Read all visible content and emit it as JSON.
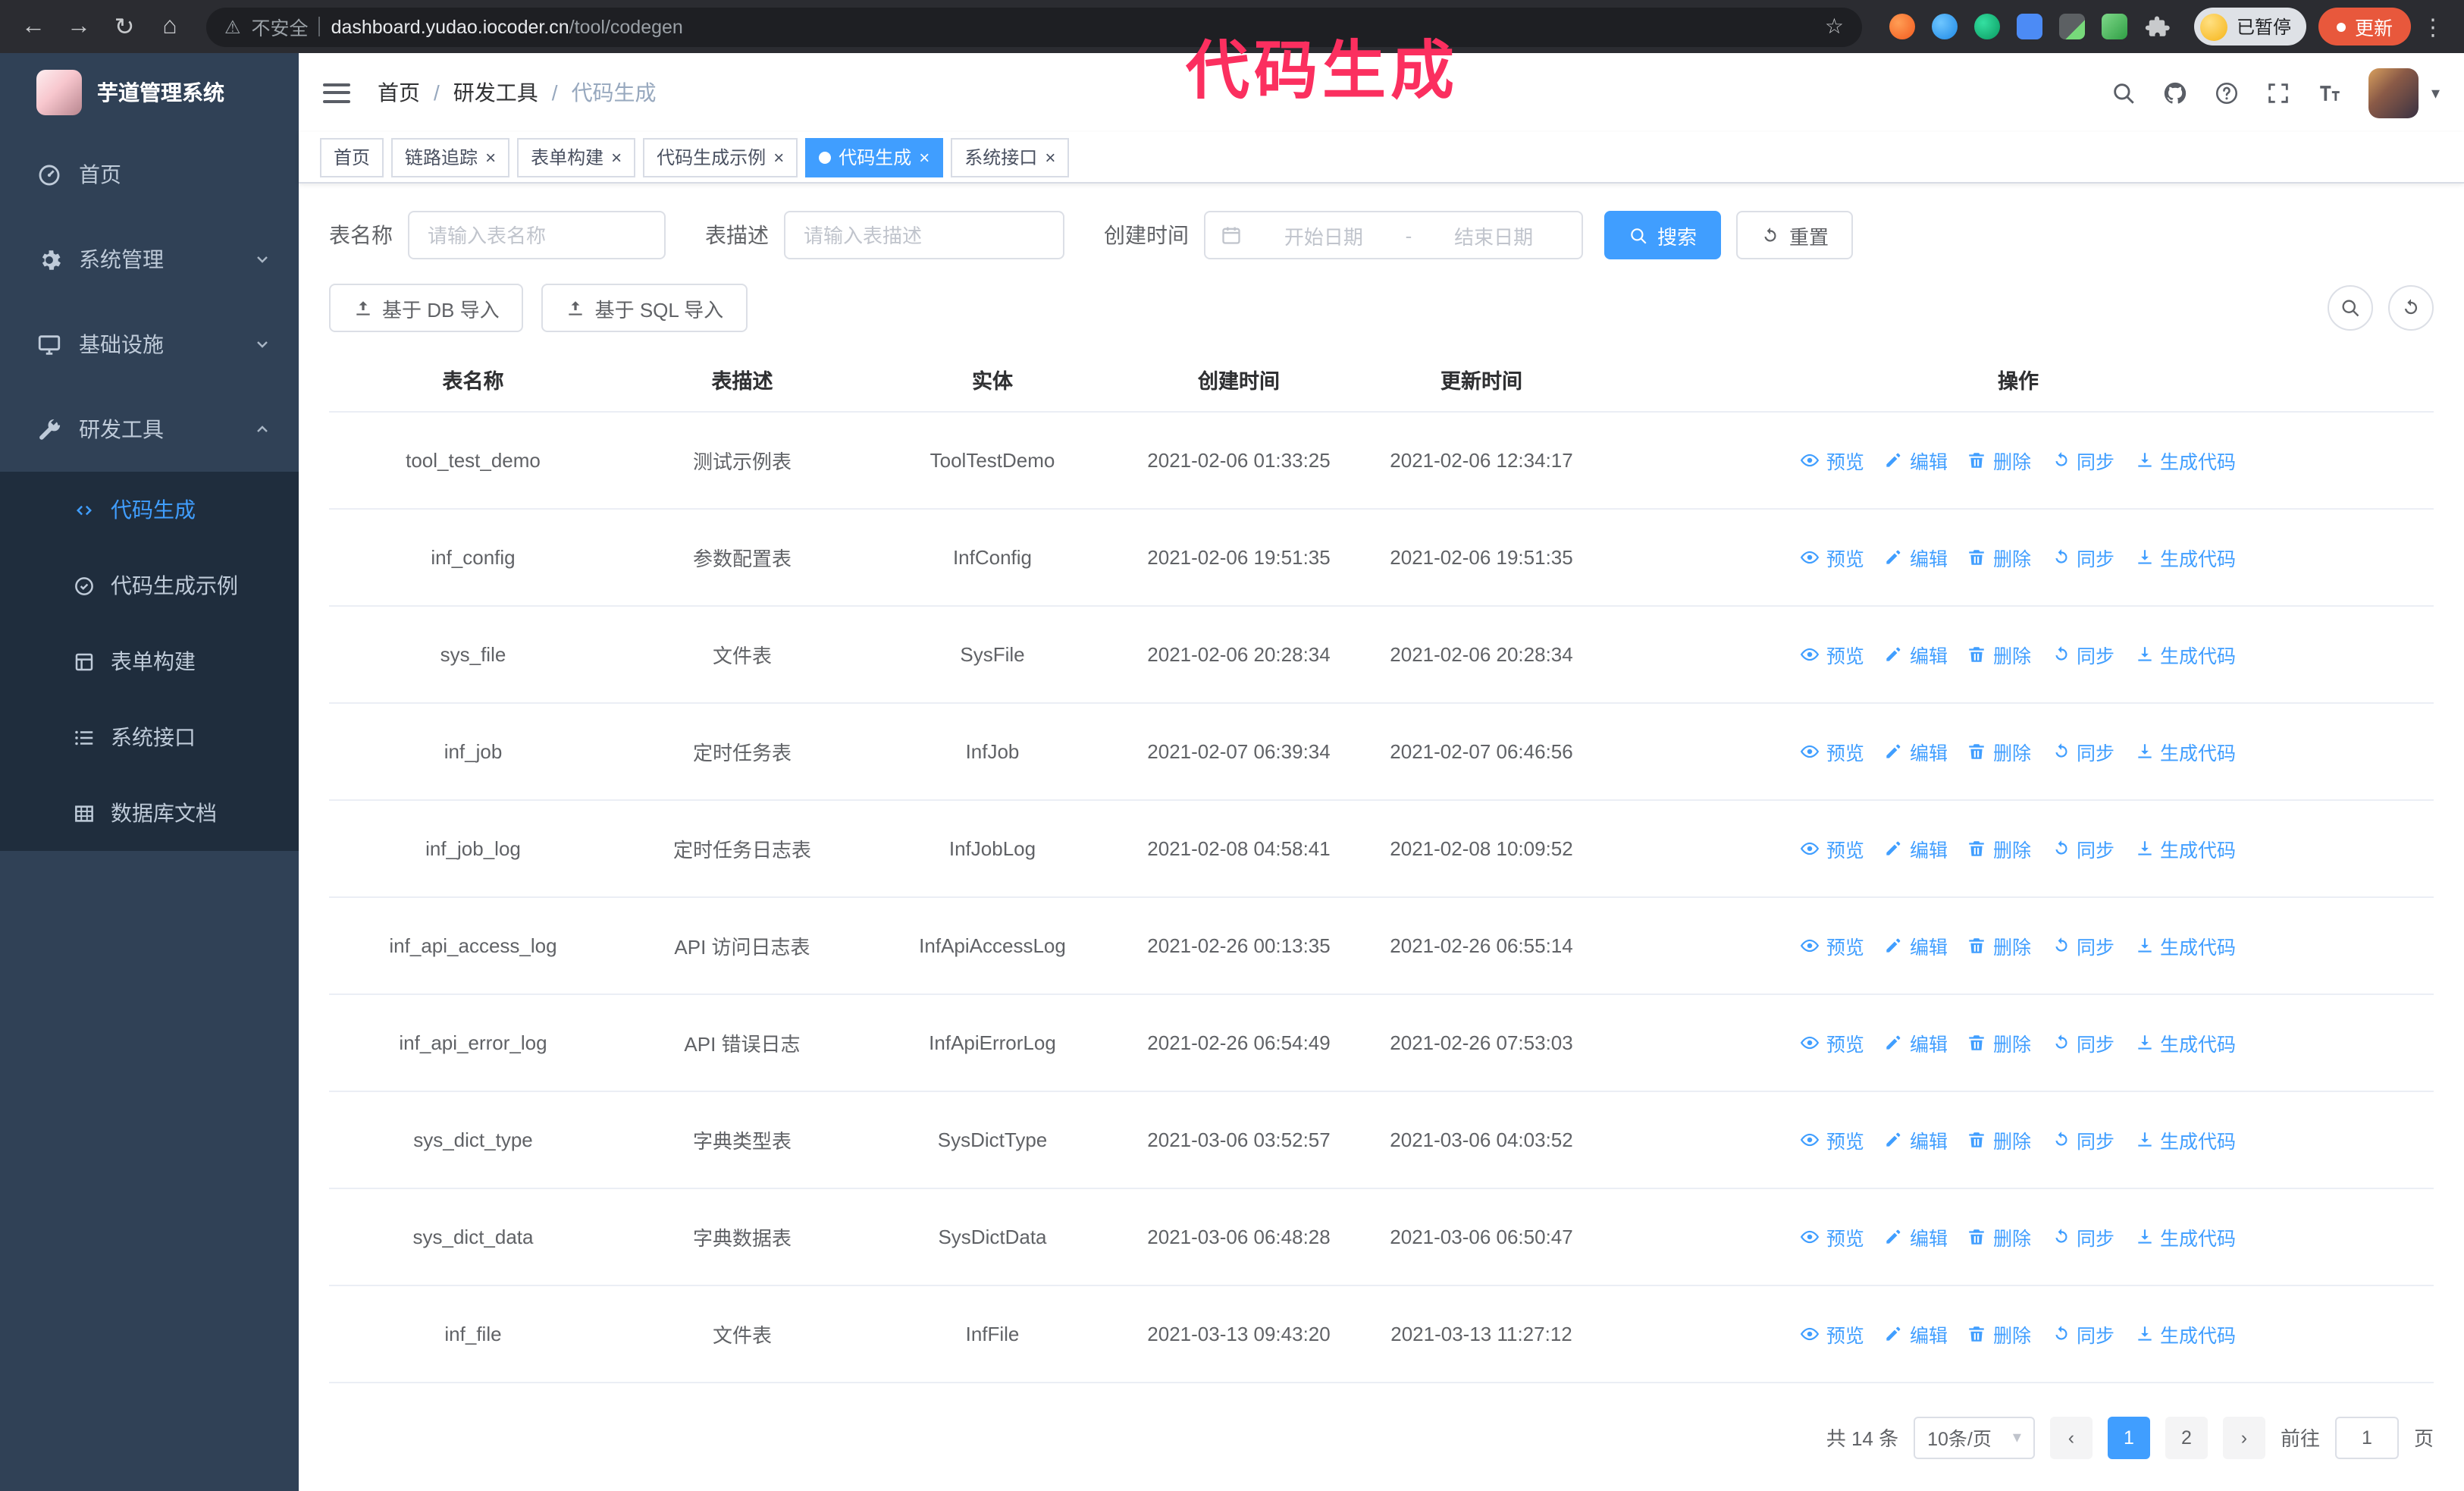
{
  "colors": {
    "accent": "#409eff",
    "sidebar_bg": "#304156",
    "submenu_bg": "#1f2d3d",
    "overlay_pink": "#fb2f5f",
    "update_button_bg": "#e8583c",
    "chrome_bg": "#2b2c31"
  },
  "icons": {
    "back": "←",
    "forward": "→",
    "reload": "↻",
    "home": "⌂",
    "warning": "⚠",
    "star": "☆",
    "kebab": "⋮",
    "close": "×",
    "caret": "▾",
    "prev": "‹",
    "next": "›"
  },
  "overlay_title": "代码生成",
  "browser": {
    "security_label": "不安全",
    "url_host": "dashboard.yudao.iocoder.cn",
    "url_path": "/tool/codegen",
    "paused_badge": "已暂停",
    "update_button": "更新"
  },
  "sidebar": {
    "logo_title": "芋道管理系统",
    "items": [
      {
        "label": "首页"
      },
      {
        "label": "系统管理"
      },
      {
        "label": "基础设施"
      },
      {
        "label": "研发工具"
      }
    ],
    "sub_items": [
      {
        "label": "代码生成"
      },
      {
        "label": "代码生成示例"
      },
      {
        "label": "表单构建"
      },
      {
        "label": "系统接口"
      },
      {
        "label": "数据库文档"
      }
    ]
  },
  "header": {
    "breadcrumb": [
      "首页",
      "研发工具",
      "代码生成"
    ],
    "separator": "/"
  },
  "tabs": [
    {
      "label": "首页"
    },
    {
      "label": "链路追踪"
    },
    {
      "label": "表单构建"
    },
    {
      "label": "代码生成示例"
    },
    {
      "label": "代码生成"
    },
    {
      "label": "系统接口"
    }
  ],
  "filters": {
    "name_label": "表名称",
    "name_placeholder": "请输入表名称",
    "desc_label": "表描述",
    "desc_placeholder": "请输入表描述",
    "time_label": "创建时间",
    "start_placeholder": "开始日期",
    "range_separator": "-",
    "end_placeholder": "结束日期",
    "search_label": "搜索",
    "reset_label": "重置"
  },
  "toolbar": {
    "import_db": "基于 DB 导入",
    "import_sql": "基于 SQL 导入"
  },
  "table": {
    "columns": [
      "表名称",
      "表描述",
      "实体",
      "创建时间",
      "更新时间",
      "操作"
    ],
    "ops": {
      "preview": "预览",
      "edit": "编辑",
      "delete": "删除",
      "sync": "同步",
      "generate": "生成代码"
    },
    "rows": [
      {
        "name": "tool_test_demo",
        "desc": "测试示例表",
        "entity": "ToolTestDemo",
        "created": "2021-02-06 01:33:25",
        "updated": "2021-02-06 12:34:17"
      },
      {
        "name": "inf_config",
        "desc": "参数配置表",
        "entity": "InfConfig",
        "created": "2021-02-06 19:51:35",
        "updated": "2021-02-06 19:51:35"
      },
      {
        "name": "sys_file",
        "desc": "文件表",
        "entity": "SysFile",
        "created": "2021-02-06 20:28:34",
        "updated": "2021-02-06 20:28:34"
      },
      {
        "name": "inf_job",
        "desc": "定时任务表",
        "entity": "InfJob",
        "created": "2021-02-07 06:39:34",
        "updated": "2021-02-07 06:46:56"
      },
      {
        "name": "inf_job_log",
        "desc": "定时任务日志表",
        "entity": "InfJobLog",
        "created": "2021-02-08 04:58:41",
        "updated": "2021-02-08 10:09:52"
      },
      {
        "name": "inf_api_access_log",
        "desc": "API 访问日志表",
        "entity": "InfApiAccessLog",
        "created": "2021-02-26 00:13:35",
        "updated": "2021-02-26 06:55:14"
      },
      {
        "name": "inf_api_error_log",
        "desc": "API 错误日志",
        "entity": "InfApiErrorLog",
        "created": "2021-02-26 06:54:49",
        "updated": "2021-02-26 07:53:03"
      },
      {
        "name": "sys_dict_type",
        "desc": "字典类型表",
        "entity": "SysDictType",
        "created": "2021-03-06 03:52:57",
        "updated": "2021-03-06 04:03:52"
      },
      {
        "name": "sys_dict_data",
        "desc": "字典数据表",
        "entity": "SysDictData",
        "created": "2021-03-06 06:48:28",
        "updated": "2021-03-06 06:50:47"
      },
      {
        "name": "inf_file",
        "desc": "文件表",
        "entity": "InfFile",
        "created": "2021-03-13 09:43:20",
        "updated": "2021-03-13 11:27:12"
      }
    ]
  },
  "pagination": {
    "total": "共 14 条",
    "page_size": "10条/页",
    "pages": [
      "1",
      "2"
    ],
    "goto_label": "前往",
    "goto_value": "1",
    "page_suffix": "页"
  }
}
